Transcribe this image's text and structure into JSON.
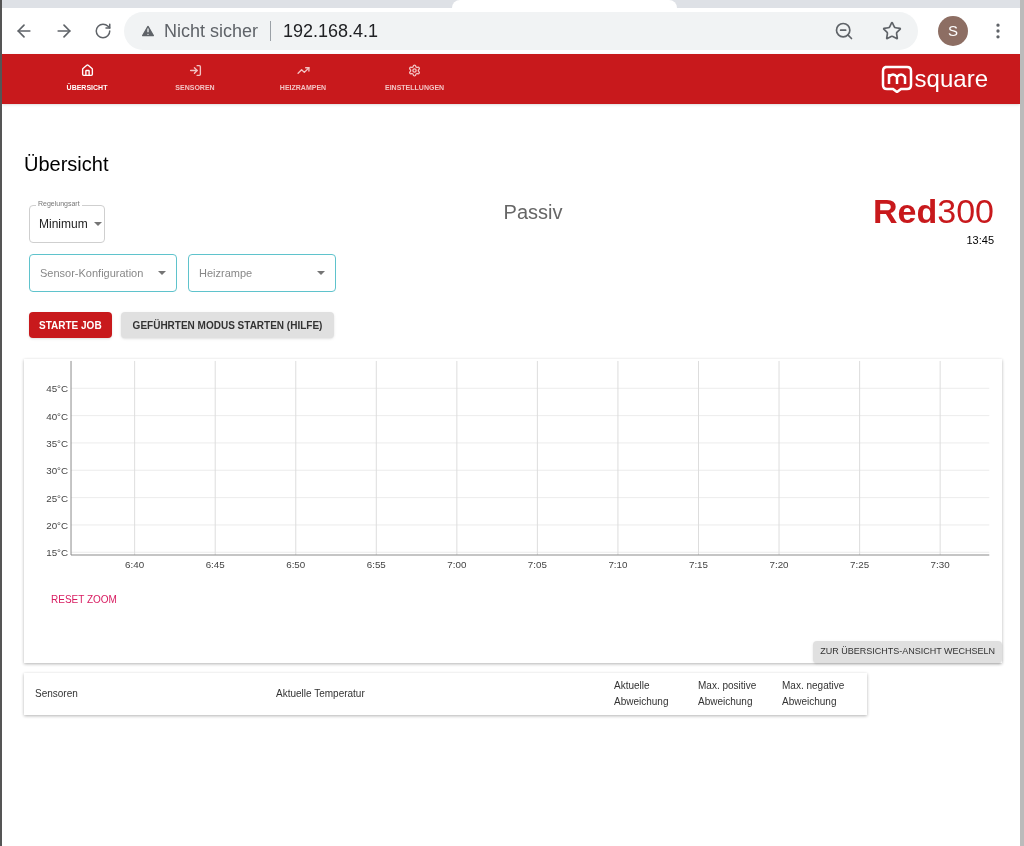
{
  "browser": {
    "security": "Nicht sicher",
    "url": "192.168.4.1",
    "avatar": "S"
  },
  "nav": {
    "items": [
      {
        "label": "ÜBERSICHT",
        "selected": true
      },
      {
        "label": "SENSOREN",
        "selected": false
      },
      {
        "label": "HEIZRAMPEN",
        "selected": false
      },
      {
        "label": "EINSTELLUNGEN",
        "selected": false
      }
    ],
    "logo_text": "square"
  },
  "page": {
    "title": "Übersicht",
    "status": "Passiv",
    "model": {
      "name": "Red",
      "number": "300"
    },
    "time": "13:45"
  },
  "regelungsart": {
    "label": "Regelungsart",
    "value": "Minimum"
  },
  "selects": [
    {
      "placeholder": "Sensor-Konfiguration"
    },
    {
      "placeholder": "Heizrampe"
    }
  ],
  "buttons": [
    {
      "label": "STARTE JOB",
      "kind": "primary"
    },
    {
      "label": "GEFÜHRTEN MODUS STARTEN (HILFE)",
      "kind": "secondary"
    }
  ],
  "chart": {
    "chart_data": {
      "type": "line",
      "grid": true,
      "ylim": [
        14.5,
        50
      ],
      "categories": [
        "6:40",
        "6:45",
        "6:50",
        "6:55",
        "7:00",
        "7:05",
        "7:10",
        "7:15",
        "7:20",
        "7:25",
        "7:30"
      ],
      "yticks": [
        {
          "value": 15,
          "label": "15°C"
        },
        {
          "value": 20,
          "label": "20°C"
        },
        {
          "value": 25,
          "label": "25°C"
        },
        {
          "value": 30,
          "label": "30°C"
        },
        {
          "value": 35,
          "label": "35°C"
        },
        {
          "value": 40,
          "label": "40°C"
        },
        {
          "value": 45,
          "label": "45°C"
        }
      ]
    },
    "reset_zoom": "RESET ZOOM",
    "switch_view": "ZUR ÜBERSICHTS-ANSICHT WECHSELN"
  },
  "table": {
    "columns": [
      "Sensoren",
      "Aktuelle Temperatur",
      "Aktuelle Abweichung",
      "Max. positive Abweichung",
      "Max. negative Abweichung"
    ]
  }
}
